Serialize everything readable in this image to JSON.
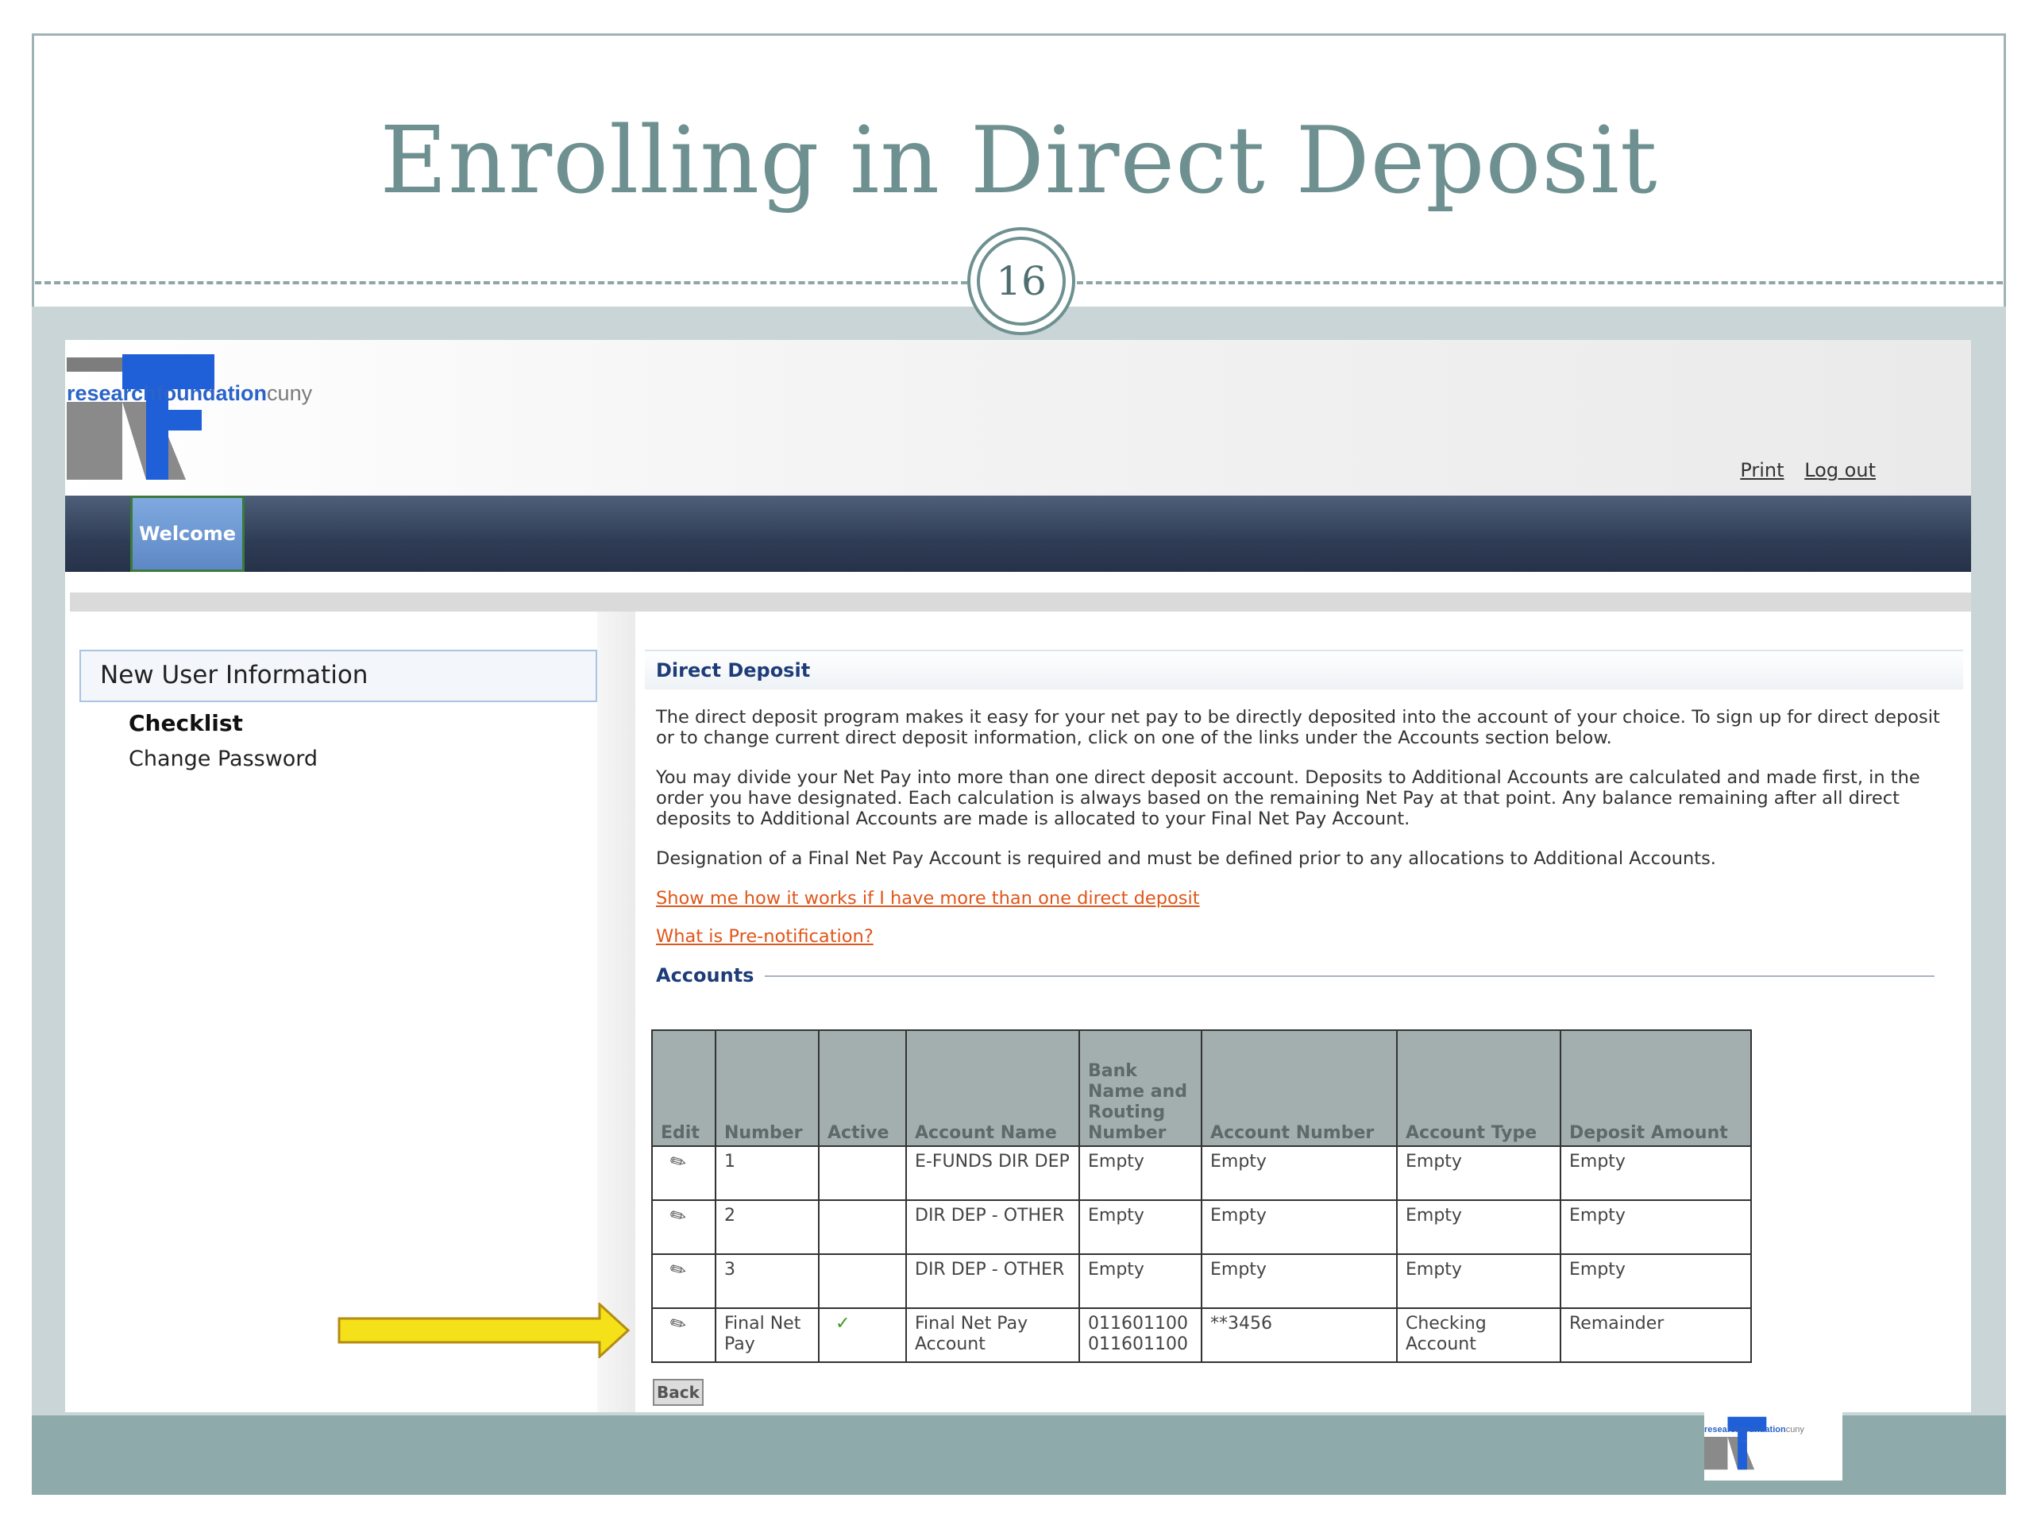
{
  "slide": {
    "title": "Enrolling in Direct Deposit",
    "number": "16"
  },
  "logo": {
    "brand_bold": "researchfoundation",
    "brand_light": "cuny"
  },
  "header": {
    "print_label": "Print",
    "logout_label": "Log out"
  },
  "nav": {
    "tabs": [
      {
        "label": "Welcome",
        "active": true
      }
    ]
  },
  "sidebar": {
    "section_title": "New User Information",
    "items": [
      {
        "label": "Checklist",
        "bold": true
      },
      {
        "label": "Change Password",
        "bold": false
      }
    ]
  },
  "main": {
    "heading": "Direct Deposit",
    "paragraphs": [
      "The direct deposit program makes it easy for your net pay to be directly deposited into the account of your choice. To sign up for direct deposit or to change current direct deposit information, click on one of the links under the Accounts section below.",
      "You may divide your Net Pay into more than one direct deposit account. Deposits to Additional Accounts are calculated and made first, in the order you have designated. Each calculation is always based on the remaining Net Pay at that point. Any balance remaining after all direct deposits to Additional Accounts are made is allocated to your Final Net Pay Account.",
      "Designation of a Final Net Pay Account is required and must be defined prior to any allocations to Additional Accounts."
    ],
    "links": [
      "Show me how it works if I have more than one direct deposit",
      "What is Pre-notification?"
    ],
    "accounts_label": "Accounts",
    "back_label": "Back"
  },
  "accounts_table": {
    "headers": [
      "Edit",
      "Number",
      "Active",
      "Account Name",
      "Bank Name and Routing Number",
      "Account Number",
      "Account Type",
      "Deposit Amount"
    ],
    "rows": [
      {
        "number": "1",
        "active": "",
        "account_name": "E-FUNDS DIR DEP",
        "bank_routing": "Empty",
        "account_number": "Empty",
        "account_type": "Empty",
        "deposit_amount": "Empty"
      },
      {
        "number": "2",
        "active": "",
        "account_name": "DIR DEP - OTHER",
        "bank_routing": "Empty",
        "account_number": "Empty",
        "account_type": "Empty",
        "deposit_amount": "Empty"
      },
      {
        "number": "3",
        "active": "",
        "account_name": "DIR DEP - OTHER",
        "bank_routing": "Empty",
        "account_number": "Empty",
        "account_type": "Empty",
        "deposit_amount": "Empty"
      },
      {
        "number": "Final Net Pay",
        "active": "✓",
        "account_name": "Final Net Pay Account",
        "bank_routing": "011601100 011601100",
        "account_number": "**3456",
        "account_type": "Checking Account",
        "deposit_amount": "Remainder"
      }
    ]
  },
  "icons": {
    "edit": "pencil-icon",
    "active": "checkmark-icon",
    "pointer": "arrow-right-icon"
  },
  "colors": {
    "title": "#6f9090",
    "nav_dark": "#2f3c55",
    "nav_tab": "#6f98d4",
    "link": "#e0561a",
    "heading_blue": "#1d3c78",
    "arrow": "#f4e11a"
  }
}
